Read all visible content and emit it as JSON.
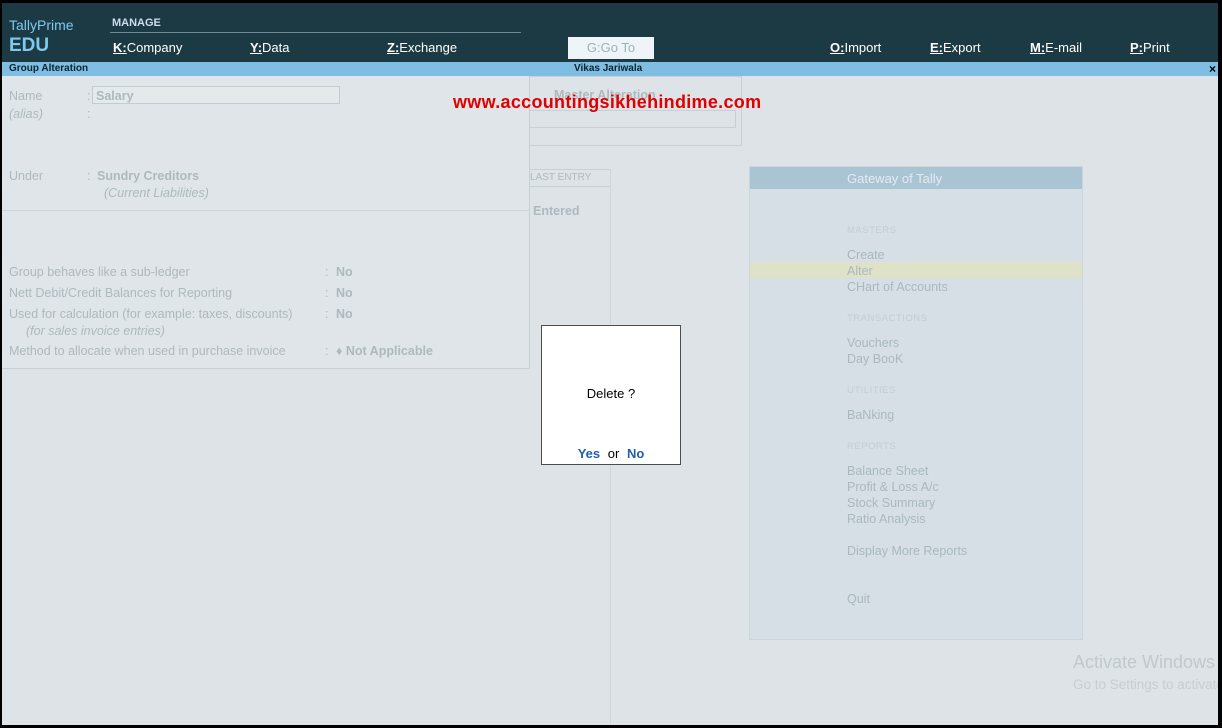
{
  "header": {
    "brand_name": "TallyPrime",
    "brand_edition": "EDU",
    "section_label": "MANAGE",
    "menu": [
      {
        "key": "K:",
        "label": "Company"
      },
      {
        "key": "Y:",
        "label": "Data"
      },
      {
        "key": "Z:",
        "label": "Exchange"
      },
      {
        "key": "G:",
        "label": "Go To"
      },
      {
        "key": "O:",
        "label": "Import"
      },
      {
        "key": "E:",
        "label": "Export"
      },
      {
        "key": "M:",
        "label": "E-mail"
      },
      {
        "key": "P:",
        "label": "Print"
      }
    ]
  },
  "titlebar": {
    "screen_title": "Group Alteration",
    "company": "Vikas Jariwala",
    "close_glyph": "×"
  },
  "watermark": "www.accountingsikhehindime.com",
  "form": {
    "name_label": "Name",
    "name_value": "Salary",
    "alias_label": "(alias)",
    "under_label": "Under",
    "under_value": "Sundry Creditors",
    "under_parent": "(Current Liabilities)",
    "fields": [
      {
        "label": "Group behaves like a sub-ledger",
        "value": "No"
      },
      {
        "label": "Nett Debit/Credit Balances for Reporting",
        "value": "No"
      },
      {
        "label": "Used for calculation (for example: taxes, discounts)",
        "value": "No"
      },
      {
        "label": "Method to allocate when used in purchase invoice",
        "value": "♦ Not Applicable"
      }
    ],
    "sales_note": "(for sales invoice entries)",
    "colon": ":"
  },
  "background": {
    "master_alteration": "Master Alteration",
    "last_entry": "LAST ENTRY",
    "entered": "Entered"
  },
  "gateway": {
    "title": "Gateway of Tally",
    "sections": {
      "masters": "MASTERS",
      "transactions": "TRANSACTIONS",
      "utilities": "UTILITIES",
      "reports": "REPORTS"
    },
    "items": {
      "create": "Create",
      "alter": "Alter",
      "chart": "CHart of Accounts",
      "vouchers": "Vouchers",
      "daybook": "Day BooK",
      "banking": "BaNking",
      "balance": "Balance Sheet",
      "pl": "Profit & Loss A/c",
      "stock": "Stock Summary",
      "ratio": "Ratio Analysis",
      "more": "Display More Reports",
      "quit": "Quit"
    }
  },
  "os_watermark": {
    "line1": "Activate Windows",
    "line2": "Go to Settings to activate Windows."
  },
  "dialog": {
    "question": "Delete ?",
    "yes": "Yes",
    "or": "or",
    "no": "No"
  }
}
